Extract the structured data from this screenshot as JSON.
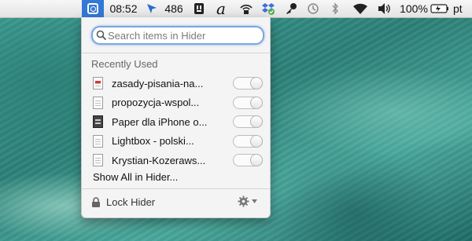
{
  "menubar": {
    "time": "08:52",
    "cursor_count": "486",
    "battery": "100%",
    "input_source": "pt",
    "icons": [
      "hider-icon",
      "cursor-icon",
      "app-icon",
      "script-a-icon",
      "wireless-icon",
      "dropbox-icon",
      "key-icon",
      "time-machine-icon",
      "bluetooth-icon",
      "wifi-icon",
      "volume-icon",
      "battery-icon"
    ]
  },
  "search": {
    "placeholder": "Search items in Hider",
    "value": ""
  },
  "recent": {
    "title": "Recently Used",
    "items": [
      {
        "label": "zasady-pisania-na...",
        "icon": "document-red-icon",
        "hidden": false
      },
      {
        "label": "propozycja-wspol...",
        "icon": "document-icon",
        "hidden": false
      },
      {
        "label": "Paper dla iPhone o...",
        "icon": "document-dark-icon",
        "hidden": false
      },
      {
        "label": "Lightbox - polski...",
        "icon": "document-icon",
        "hidden": false
      },
      {
        "label": "Krystian-Kozeraws...",
        "icon": "document-icon",
        "hidden": false
      }
    ]
  },
  "show_all": "Show All in Hider...",
  "footer": {
    "lock_label": "Lock Hider"
  },
  "colors": {
    "accent": "#3478d6",
    "focus_ring": "#7aa7e0"
  }
}
